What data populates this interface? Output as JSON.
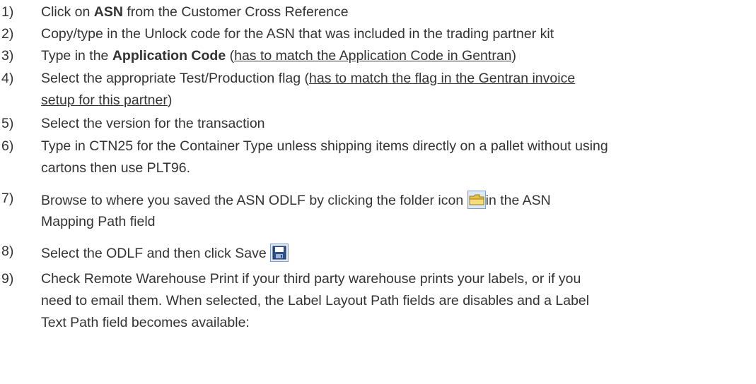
{
  "steps": [
    {
      "num": "1)",
      "pre": "Click on ",
      "bold": "ASN",
      "post": " from the Customer Cross Reference"
    },
    {
      "num": "2)",
      "text": "Copy/type in the Unlock code for the ASN that was included in the trading partner kit"
    },
    {
      "num": "3)",
      "pre": "Type in the ",
      "bold": "Application Code",
      "mid": " (",
      "underline": "has to match the Application Code in Gentran",
      "post": ")"
    },
    {
      "num": "4)",
      "pre": "Select the appropriate Test/Production flag (",
      "underline": "has to match the flag in the Gentran invoice",
      "line2_underline": "setup for this partner",
      "line2_post": ")"
    },
    {
      "num": "5)",
      "text": "Select the version for the transaction"
    },
    {
      "num": "6)",
      "text": "Type in CTN25 for the Container Type unless shipping items directly on a pallet without using",
      "line2": "cartons then use PLT96."
    },
    {
      "num": "7)",
      "pre": "Browse to where you saved the ASN ODLF by clicking the folder icon ",
      "post": "in the ASN",
      "line2": "Mapping Path field",
      "icon": "folder-icon"
    },
    {
      "num": "8)",
      "pre": "Select the ODLF and then click Save ",
      "icon": "save-icon"
    },
    {
      "num": "9)",
      "text": "Check Remote Warehouse Print if your third party warehouse prints your labels, or if you",
      "line2": "need to email them.  When selected, the Label Layout Path fields are disables and a Label",
      "line3": "Text Path field becomes available:"
    }
  ]
}
